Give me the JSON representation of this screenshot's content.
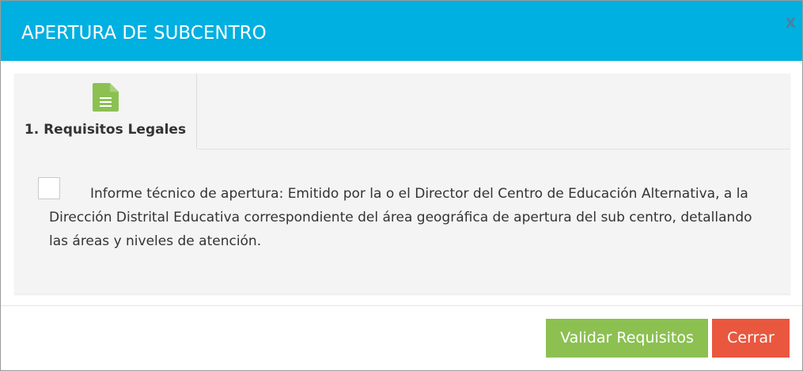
{
  "header": {
    "title": "APERTURA DE SUBCENTRO",
    "close_label": "X"
  },
  "tabs": [
    {
      "label": "1. Requisitos Legales",
      "icon": "document-icon",
      "icon_color": "#8cc152"
    }
  ],
  "requirements": [
    {
      "checked": false,
      "text": "Informe técnico de apertura: Emitido por la o el Director del Centro de Educación Alternativa, a la Dirección Distrital Educativa correspondiente del área geográfica de apertura del sub centro, detallando las áreas y niveles de atención."
    }
  ],
  "footer": {
    "validate_label": "Validar Requisitos",
    "close_label": "Cerrar"
  },
  "colors": {
    "header_bg": "#00b0e0",
    "validate_bg": "#8cc152",
    "close_bg": "#e9573f"
  }
}
